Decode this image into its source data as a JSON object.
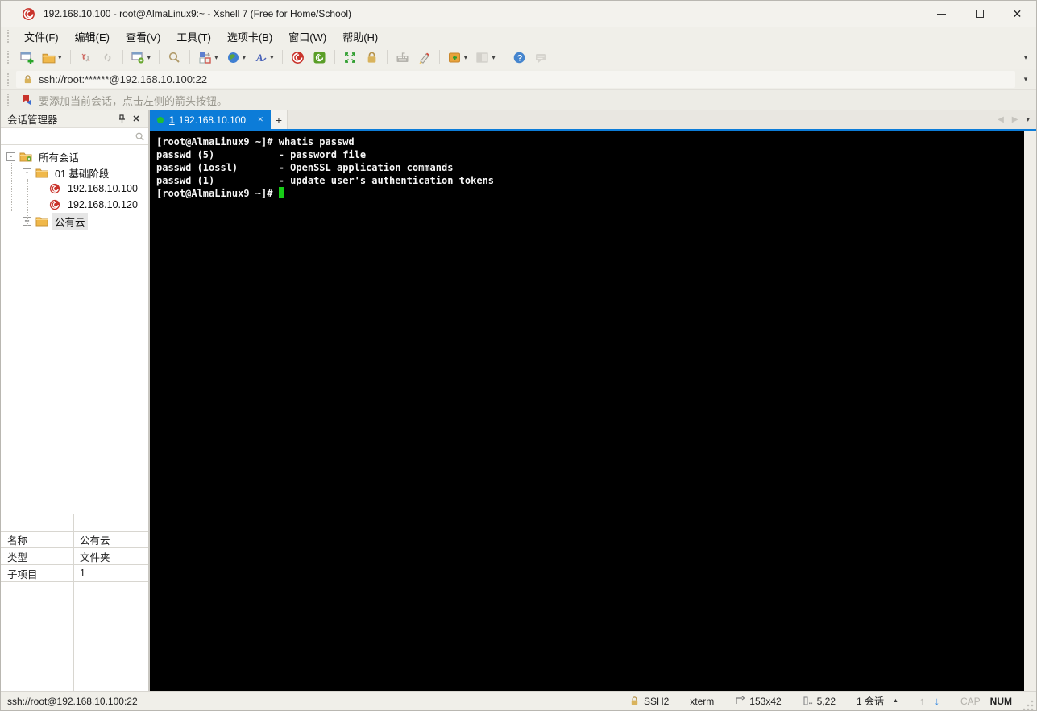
{
  "window": {
    "title": "192.168.10.100 - root@AlmaLinux9:~ - Xshell 7 (Free for Home/School)"
  },
  "menu": {
    "items": [
      {
        "label": "文件(F)"
      },
      {
        "label": "编辑(E)"
      },
      {
        "label": "查看(V)"
      },
      {
        "label": "工具(T)"
      },
      {
        "label": "选项卡(B)"
      },
      {
        "label": "窗口(W)"
      },
      {
        "label": "帮助(H)"
      }
    ]
  },
  "toolbar": {
    "icons": [
      "new-session",
      "open-session",
      "disconnect",
      "reconnect",
      "session-properties",
      "find",
      "new-file-transfer",
      "web-browser",
      "font",
      "xshell",
      "xftp",
      "full-screen",
      "lock-screen",
      "virtual-keyboard",
      "highlight-pen",
      "new-terminal",
      "tile-windows",
      "help",
      "feedback"
    ]
  },
  "address_bar": {
    "url": "ssh://root:******@192.168.10.100:22"
  },
  "info_bar": {
    "text": "要添加当前会话，点击左侧的箭头按钮。"
  },
  "session_manager": {
    "title": "会话管理器",
    "tree": {
      "items": [
        {
          "label": "所有会话",
          "type": "root-folder",
          "expanded": true
        },
        {
          "label": "01 基础阶段",
          "type": "folder",
          "expanded": true
        },
        {
          "label": "192.168.10.100",
          "type": "session"
        },
        {
          "label": "192.168.10.120",
          "type": "session"
        },
        {
          "label": "公有云",
          "type": "folder",
          "expanded": false,
          "selected": true
        }
      ]
    },
    "properties": [
      {
        "name": "名称",
        "value": "公有云"
      },
      {
        "name": "类型",
        "value": "文件夹"
      },
      {
        "name": "子项目",
        "value": "1"
      }
    ]
  },
  "tabs": {
    "active": {
      "number": "1",
      "label": "192.168.10.100",
      "connected": true
    }
  },
  "terminal": {
    "lines": {
      "0": "[root@AlmaLinux9 ~]# whatis passwd",
      "1": "passwd (5)           - password file",
      "2": "passwd (1ossl)       - OpenSSL application commands",
      "3": "passwd (1)           - update user's authentication tokens",
      "4": "[root@AlmaLinux9 ~]# "
    }
  },
  "status_bar": {
    "connection": "ssh://root@192.168.10.100:22",
    "protocol": "SSH2",
    "terminal_type": "xterm",
    "size": "153x42",
    "cursor_position": "5,22",
    "session_count": "1 会话",
    "cap_indicator": "CAP",
    "num_indicator": "NUM"
  },
  "icons": {
    "caret_down": "▾",
    "close": "✕",
    "maximize_glyph": "□",
    "new_tab": "+",
    "nav_left": "◀",
    "nav_right": "▶",
    "popup_arrow": "▲",
    "up_arrow": "↑",
    "down_arrow": "↓",
    "tree_collapse": "-",
    "tree_expand": "+"
  },
  "colors": {
    "active_tab": "#0c7cd8",
    "terminal_background": "#000000",
    "terminal_text": "#f5f5f5",
    "cursor_green": "#17cc17",
    "brand_red": "#c9342c",
    "xftp_green": "#5a9e27",
    "folder_yellow": "#f0b84a",
    "lock_gold": "#d9b35c",
    "selection_gray": "#e6e6e6"
  }
}
